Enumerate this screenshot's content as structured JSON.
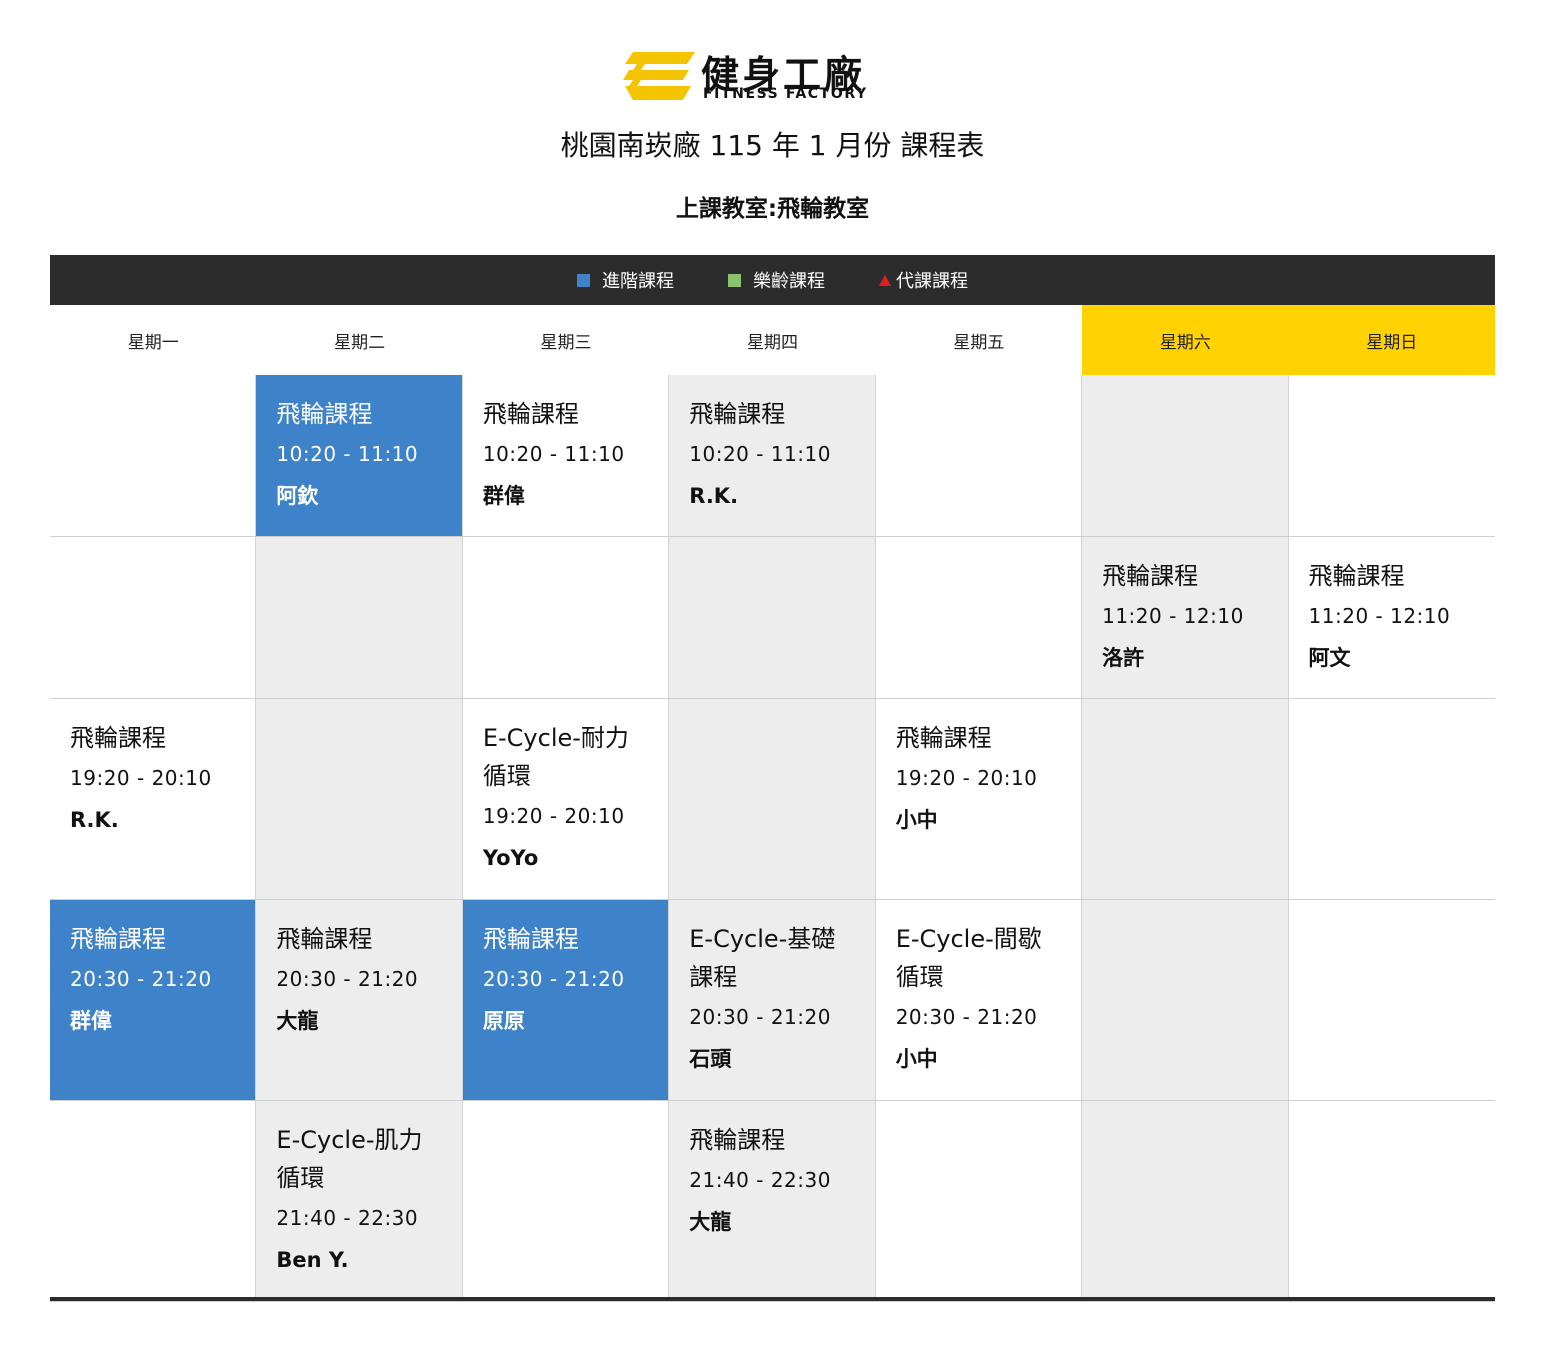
{
  "logo": {
    "name_zh": "健身工廠",
    "name_en": "FITNESS FACTORY",
    "icon": "ff-logo-icon",
    "accent": "#f5c400"
  },
  "title": "桃園南崁廠 115 年 1 月份 課程表",
  "subtitle": "上課教室:飛輪教室",
  "legend": [
    {
      "label": "進階課程",
      "marker": "square",
      "color": "#3e83c9"
    },
    {
      "label": "樂齡課程",
      "marker": "square",
      "color": "#8cc26b"
    },
    {
      "label": "代課課程",
      "marker": "triangle",
      "color": "#e02020"
    }
  ],
  "days": [
    "星期一",
    "星期二",
    "星期三",
    "星期四",
    "星期五",
    "星期六",
    "星期日"
  ],
  "colors": {
    "advanced": "#3e83c9",
    "weekend_header": "#ffd200",
    "empty_gray": "#ededed",
    "bar": "#2c2c2c"
  },
  "rows": [
    {
      "cells": [
        {
          "bg": "white"
        },
        {
          "bg": "blue",
          "name": "飛輪課程",
          "time": "10:20 - 11:10",
          "instructor": "阿欽"
        },
        {
          "bg": "white",
          "name": "飛輪課程",
          "time": "10:20 - 11:10",
          "instructor": "群偉"
        },
        {
          "bg": "gray",
          "name": "飛輪課程",
          "time": "10:20 - 11:10",
          "instructor": "R.K."
        },
        {
          "bg": "white"
        },
        {
          "bg": "gray"
        },
        {
          "bg": "white"
        }
      ]
    },
    {
      "cells": [
        {
          "bg": "white"
        },
        {
          "bg": "gray"
        },
        {
          "bg": "white"
        },
        {
          "bg": "gray"
        },
        {
          "bg": "white"
        },
        {
          "bg": "gray",
          "name": "飛輪課程",
          "time": "11:20 - 12:10",
          "instructor": "洛許"
        },
        {
          "bg": "white",
          "name": "飛輪課程",
          "time": "11:20 - 12:10",
          "instructor": "阿文"
        }
      ]
    },
    {
      "cells": [
        {
          "bg": "white",
          "name": "飛輪課程",
          "time": "19:20 - 20:10",
          "instructor": "R.K."
        },
        {
          "bg": "gray"
        },
        {
          "bg": "white",
          "name": "E-Cycle-耐力循環",
          "time": "19:20 - 20:10",
          "instructor": "YoYo"
        },
        {
          "bg": "gray"
        },
        {
          "bg": "white",
          "name": "飛輪課程",
          "time": "19:20 - 20:10",
          "instructor": "小中"
        },
        {
          "bg": "gray"
        },
        {
          "bg": "white"
        }
      ]
    },
    {
      "cells": [
        {
          "bg": "blue",
          "name": "飛輪課程",
          "time": "20:30 - 21:20",
          "instructor": "群偉"
        },
        {
          "bg": "gray",
          "name": "飛輪課程",
          "time": "20:30 - 21:20",
          "instructor": "大龍"
        },
        {
          "bg": "blue",
          "name": "飛輪課程",
          "time": "20:30 - 21:20",
          "instructor": "原原"
        },
        {
          "bg": "gray",
          "name": "E-Cycle-基礎課程",
          "time": "20:30 - 21:20",
          "instructor": "石頭"
        },
        {
          "bg": "white",
          "name": "E-Cycle-間歇循環",
          "time": "20:30 - 21:20",
          "instructor": "小中"
        },
        {
          "bg": "gray"
        },
        {
          "bg": "white"
        }
      ]
    },
    {
      "cells": [
        {
          "bg": "white"
        },
        {
          "bg": "gray",
          "name": "E-Cycle-肌力循環",
          "time": "21:40 - 22:30",
          "instructor": "Ben Y."
        },
        {
          "bg": "white"
        },
        {
          "bg": "gray",
          "name": "飛輪課程",
          "time": "21:40 - 22:30",
          "instructor": "大龍"
        },
        {
          "bg": "white"
        },
        {
          "bg": "gray"
        },
        {
          "bg": "white"
        }
      ]
    }
  ]
}
